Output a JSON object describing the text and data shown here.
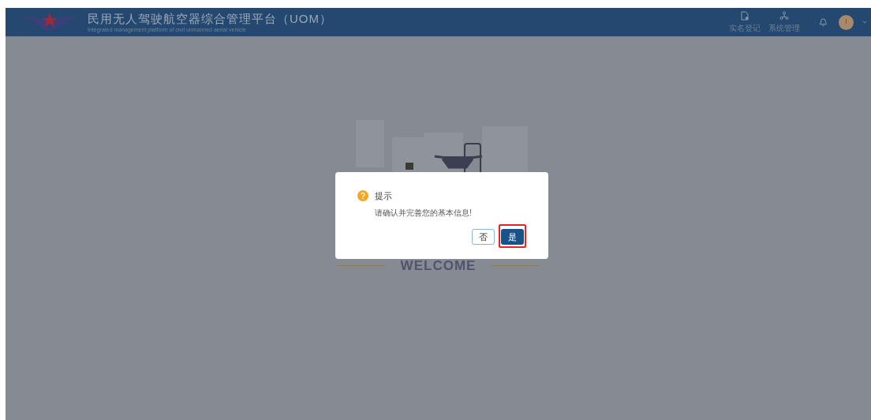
{
  "header": {
    "title": "民用无人驾驶航空器综合管理平台（UOM）",
    "subtitle": "Integrated management platform of civil unmanned aerial vehicle",
    "nav": [
      {
        "label": "实名登记",
        "kind": "document"
      },
      {
        "label": "系统管理",
        "kind": "network"
      }
    ],
    "avatar": "I"
  },
  "welcome": "WELCOME",
  "dialog": {
    "title": "提示",
    "message": "请确认并完善您的基本信息!",
    "buttons": [
      {
        "label": "否",
        "primary": false,
        "highlighted": false
      },
      {
        "label": "是",
        "primary": true,
        "highlighted": true
      }
    ]
  }
}
